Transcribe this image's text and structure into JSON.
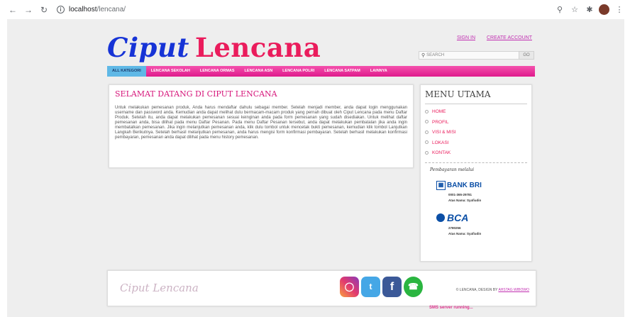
{
  "browser": {
    "url_host": "localhost",
    "url_path": "/lencana/",
    "back_icon": "arrow-left-icon",
    "forward_icon": "arrow-right-icon",
    "reload_icon": "reload-icon"
  },
  "site": {
    "logo_word1": "Ciput",
    "logo_word2": "Lencana",
    "signin": "SIGN IN",
    "create_account": "CREATE ACCOUNT",
    "search_placeholder": "SEARCH",
    "go": "GO",
    "brand_blue": "#1633d6",
    "brand_pink": "#ea1c5c"
  },
  "nav": {
    "items": [
      "ALL KATEGORI",
      "LENCANA SEKOLAH",
      "LENCANA ORMAS",
      "LENCANA ASN",
      "LENCANA POLRI",
      "LENCANA SATPAM",
      "LAINNYA"
    ]
  },
  "main": {
    "title": "SELAMAT DATANG DI CIPUT LENCANA",
    "paragraph": "Untuk melakukan pemesanan produk, Anda harus mendaftar dahulu sebagai member. Setelah menjadi member, anda dapat login menggunakan username dan password anda. Kemudian anda dapat melihat dulu bermacam-macam produk yang pernah dibuat oleh Ciput Lencana pada menu Daftar Produk. Setelah itu, anda dapat melakukan pemesanan sesuai keinginan anda pada form pemesanan yang sudah disediakan. Untuk melihat daftar pemesanan anda, bisa dilihat pada menu Daftar Pesanan. Pada menu Daftar Pesanan tersebut, anda dapat melakukan pembatalan jika anda ingin membatalkan pemesanan. Jika ingin melanjutkan pemesanan anda, klik dulu tombol untuk mencetak bukti pemesanan, kemudian klik tombol Lanjutkan Langkah Berikutnya. Setelah berhasil melanjutkan pemesanan, anda harus mengisi form konfirmasi pembayaran. Setelah berhasil melakukan konfirmasi pembayaran, pemesanan anda dapat dilihat pada menu history pemesanan."
  },
  "sidebar": {
    "title": "MENU UTAMA",
    "items": [
      "HOME",
      "PROFIL",
      "VISI & MISI",
      "LOKASI",
      "KONTAK"
    ],
    "payment_title": "Pembayaran melalui",
    "banks": [
      {
        "name": "BANK BRI",
        "account": "0001-365-29781",
        "holder": "Atas Nama: Syafiudin"
      },
      {
        "name": "BCA",
        "account": "2780256",
        "holder": "Atas Nama: Syafiudin"
      }
    ]
  },
  "footer": {
    "logo": "Ciput Lencana",
    "copyright": "© LENCANA, DESIGN BY",
    "designer": "AHSTAG WIBOWO",
    "social": [
      "instagram-icon",
      "twitter-icon",
      "facebook-icon",
      "whatsapp-icon"
    ]
  },
  "status": {
    "sms": "SMS server running..."
  }
}
